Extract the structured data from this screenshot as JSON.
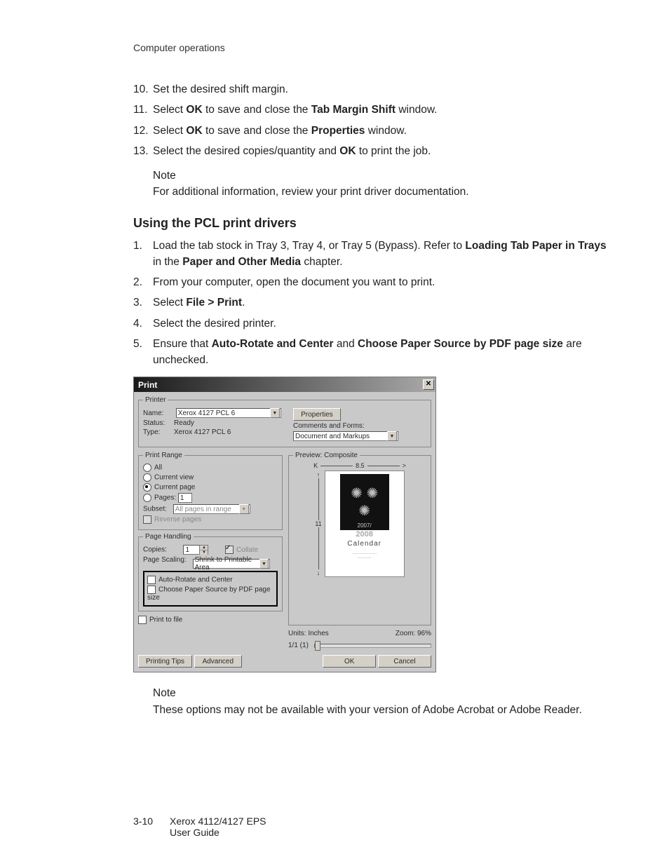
{
  "header": {
    "section": "Computer operations"
  },
  "stepsA": [
    {
      "num": "10.",
      "text": "Set the desired shift margin."
    },
    {
      "num": "11.",
      "parts": [
        "Select ",
        "OK",
        " to save and close the ",
        "Tab Margin Shift",
        " window."
      ]
    },
    {
      "num": "12.",
      "parts": [
        "Select ",
        "OK",
        " to save and close the ",
        "Properties",
        " window."
      ]
    },
    {
      "num": "13.",
      "parts": [
        "Select the desired copies/quantity and ",
        "OK",
        " to print the job."
      ]
    }
  ],
  "note1": {
    "label": "Note",
    "text": "For additional information, review your print driver documentation."
  },
  "sectionTitle": "Using the PCL print drivers",
  "stepsB": [
    {
      "num": "1.",
      "parts": [
        "Load the tab stock in Tray 3, Tray 4, or Tray 5 (Bypass). Refer to ",
        "Loading Tab Paper in Trays",
        " in the ",
        "Paper and Other Media",
        " chapter."
      ]
    },
    {
      "num": "2.",
      "text": "From your computer, open the document you want to print."
    },
    {
      "num": "3.",
      "parts": [
        "Select ",
        "File > Print",
        "."
      ]
    },
    {
      "num": "4.",
      "text": "Select the desired printer."
    },
    {
      "num": "5.",
      "parts": [
        "Ensure that ",
        "Auto-Rotate and Center",
        " and ",
        "Choose Paper Source by PDF page size",
        " are unchecked."
      ]
    }
  ],
  "dialog": {
    "title": "Print",
    "printer": {
      "legend": "Printer",
      "nameLabel": "Name:",
      "nameValue": "Xerox 4127 PCL 6",
      "statusLabel": "Status:",
      "statusValue": "Ready",
      "typeLabel": "Type:",
      "typeValue": "Xerox 4127 PCL 6",
      "propertiesBtn": "Properties",
      "commentsLabel": "Comments and Forms:",
      "commentsValue": "Document and Markups"
    },
    "range": {
      "legend": "Print Range",
      "all": "All",
      "currentView": "Current view",
      "currentPage": "Current page",
      "pagesLabel": "Pages:",
      "pagesValue": "1",
      "subsetLabel": "Subset:",
      "subsetValue": "All pages in range",
      "reverse": "Reverse pages"
    },
    "handling": {
      "legend": "Page Handling",
      "copiesLabel": "Copies:",
      "copiesValue": "1",
      "collate": "Collate",
      "scalingLabel": "Page Scaling:",
      "scalingValue": "Shrink to Printable Area",
      "autoRotate": "Auto-Rotate and Center",
      "chooseSource": "Choose Paper Source by PDF page size"
    },
    "printToFile": "Print to file",
    "preview": {
      "legend": "Preview: Composite",
      "width": "8.5",
      "height": "11",
      "yearSmall": "2007/",
      "yearBig": "2008",
      "calendar": "Calendar",
      "unitsLabel": "Units:",
      "unitsValue": "Inches",
      "zoomLabel": "Zoom:",
      "zoomValue": "96%",
      "pageIndicator": "1/1 (1)"
    },
    "buttons": {
      "tips": "Printing Tips",
      "advanced": "Advanced",
      "ok": "OK",
      "cancel": "Cancel"
    }
  },
  "note2": {
    "label": "Note",
    "text": "These options may not be available with your version of Adobe Acrobat or Adobe Reader."
  },
  "footer": {
    "pageNum": "3-10",
    "line1": "Xerox 4112/4127 EPS",
    "line2": "User Guide"
  }
}
